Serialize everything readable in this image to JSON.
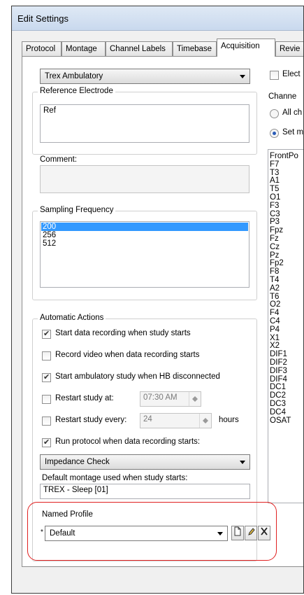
{
  "window": {
    "title": "Edit Settings"
  },
  "tabs": [
    "Protocol",
    "Montage",
    "Channel Labels",
    "Timebase",
    "Acquisition",
    "Revie"
  ],
  "active_tab": "Acquisition",
  "amplifier": {
    "selected": "Trex Ambulatory"
  },
  "reference_electrode": {
    "label": "Reference Electrode",
    "value": "Ref"
  },
  "comment": {
    "label": "Comment:",
    "value": ""
  },
  "sampling": {
    "label": "Sampling Frequency",
    "options": [
      "200",
      "256",
      "512"
    ],
    "selected": "200"
  },
  "right": {
    "elect_label": "Elect",
    "channels_label": "Channe",
    "all_label": "All ch",
    "set_label": "Set m",
    "channels": [
      "FrontPo",
      "F7",
      "T3",
      "A1",
      "T5",
      "O1",
      "F3",
      "C3",
      "P3",
      "Fpz",
      "Fz",
      "Cz",
      "Pz",
      "Fp2",
      "F8",
      "T4",
      "A2",
      "T6",
      "O2",
      "F4",
      "C4",
      "P4",
      "X1",
      "X2",
      "DIF1",
      "DIF2",
      "DIF3",
      "DIF4",
      "DC1",
      "DC2",
      "DC3",
      "DC4",
      "OSAT"
    ]
  },
  "auto": {
    "label": "Automatic Actions",
    "start_recording": {
      "label": "Start data recording when study starts",
      "checked": true
    },
    "record_video": {
      "label": "Record video when data recording starts",
      "checked": false
    },
    "start_ambulatory": {
      "label": "Start ambulatory study when HB disconnected",
      "checked": true
    },
    "restart_at": {
      "label": "Restart study at:",
      "checked": false,
      "value": "07:30 AM"
    },
    "restart_every": {
      "label": "Restart study every:",
      "checked": false,
      "value": "24",
      "unit": "hours"
    },
    "run_protocol": {
      "label": "Run protocol when data recording starts:",
      "checked": true
    },
    "protocol": "Impedance Check"
  },
  "default_montage": {
    "label": "Default montage used when study starts:",
    "value": "TREX - Sleep [01]"
  },
  "named_profile": {
    "label": "Named Profile",
    "marker": "*",
    "value": "Default"
  },
  "icons": {
    "new": "new-profile-icon",
    "edit": "edit-profile-icon",
    "delete": "delete-profile-icon"
  },
  "colors": {
    "selection": "#3399ff",
    "highlight": "#e02020"
  }
}
